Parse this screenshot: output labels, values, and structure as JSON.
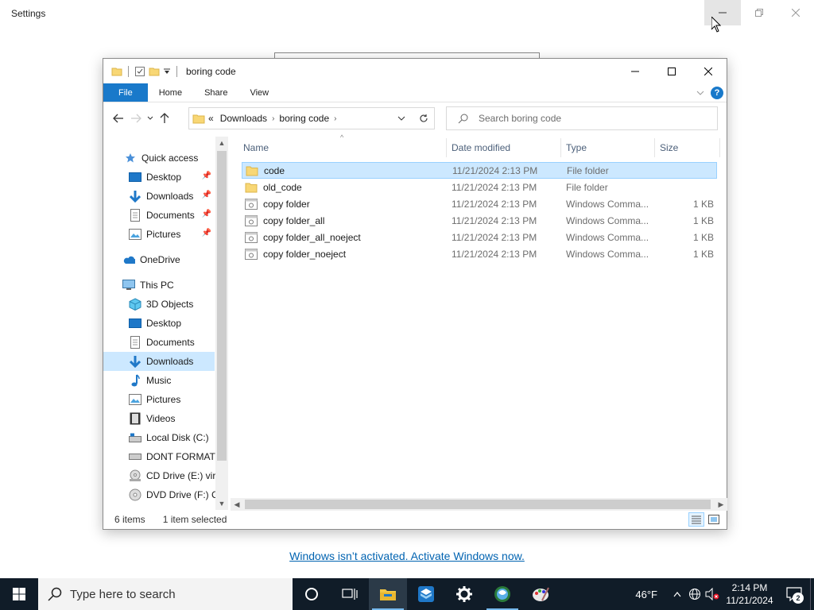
{
  "settings": {
    "title": "Settings",
    "activation_link": "Windows isn’t activated. Activate Windows now."
  },
  "explorer": {
    "title": "boring code",
    "ribbon": {
      "file": "File",
      "home": "Home",
      "share": "Share",
      "view": "View",
      "help": "?"
    },
    "address": {
      "overflow": "«",
      "crumbs": [
        "Downloads",
        "boring code"
      ]
    },
    "search": {
      "placeholder": "Search boring code"
    },
    "nav": {
      "quick_access": "Quick access",
      "qa_desktop": "Desktop",
      "qa_downloads": "Downloads",
      "qa_documents": "Documents",
      "qa_pictures": "Pictures",
      "onedrive": "OneDrive",
      "this_pc": "This PC",
      "objects3d": "3D Objects",
      "desktop": "Desktop",
      "documents": "Documents",
      "downloads": "Downloads",
      "music": "Music",
      "pictures": "Pictures",
      "videos": "Videos",
      "local_disk": "Local Disk (C:)",
      "dont_format": "DONT FORMAT (",
      "cd_drive": "CD Drive (E:) virt",
      "dvd_drive": "DVD Drive (F:) CI"
    },
    "columns": {
      "name": "Name",
      "date": "Date modified",
      "type": "Type",
      "size": "Size"
    },
    "files": [
      {
        "name": "code",
        "date": "11/21/2024 2:13 PM",
        "type": "File folder",
        "size": ""
      },
      {
        "name": "old_code",
        "date": "11/21/2024 2:13 PM",
        "type": "File folder",
        "size": ""
      },
      {
        "name": "copy folder",
        "date": "11/21/2024 2:13 PM",
        "type": "Windows Comma...",
        "size": "1 KB"
      },
      {
        "name": "copy folder_all",
        "date": "11/21/2024 2:13 PM",
        "type": "Windows Comma...",
        "size": "1 KB"
      },
      {
        "name": "copy folder_all_noeject",
        "date": "11/21/2024 2:13 PM",
        "type": "Windows Comma...",
        "size": "1 KB"
      },
      {
        "name": "copy folder_noeject",
        "date": "11/21/2024 2:13 PM",
        "type": "Windows Comma...",
        "size": "1 KB"
      }
    ],
    "status": {
      "count": "6 items",
      "selected": "1 item selected"
    }
  },
  "taskbar": {
    "search_placeholder": "Type here to search",
    "weather": "46°F",
    "time": "2:14 PM",
    "date": "11/21/2024",
    "notification_count": "2"
  },
  "colors": {
    "accent": "#1979ca",
    "selection": "#cce8ff",
    "taskbar": "#101c28",
    "link": "#0063b1"
  }
}
